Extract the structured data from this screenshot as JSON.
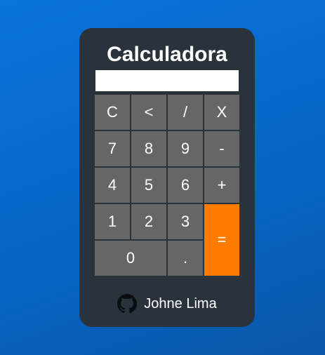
{
  "app": {
    "title": "Calculadora"
  },
  "display": {
    "value": ""
  },
  "keys": {
    "clear": "C",
    "backspace": "<",
    "divide": "/",
    "multiply": "X",
    "seven": "7",
    "eight": "8",
    "nine": "9",
    "minus": "-",
    "four": "4",
    "five": "5",
    "six": "6",
    "plus": "+",
    "one": "1",
    "two": "2",
    "three": "3",
    "equals": "=",
    "zero": "0",
    "dot": "."
  },
  "footer": {
    "icon": "github-icon",
    "author": "Johne Lima"
  },
  "colors": {
    "background": "#0a74da",
    "card": "#2a323c",
    "key": "#666666",
    "equals": "#ff7b00"
  }
}
